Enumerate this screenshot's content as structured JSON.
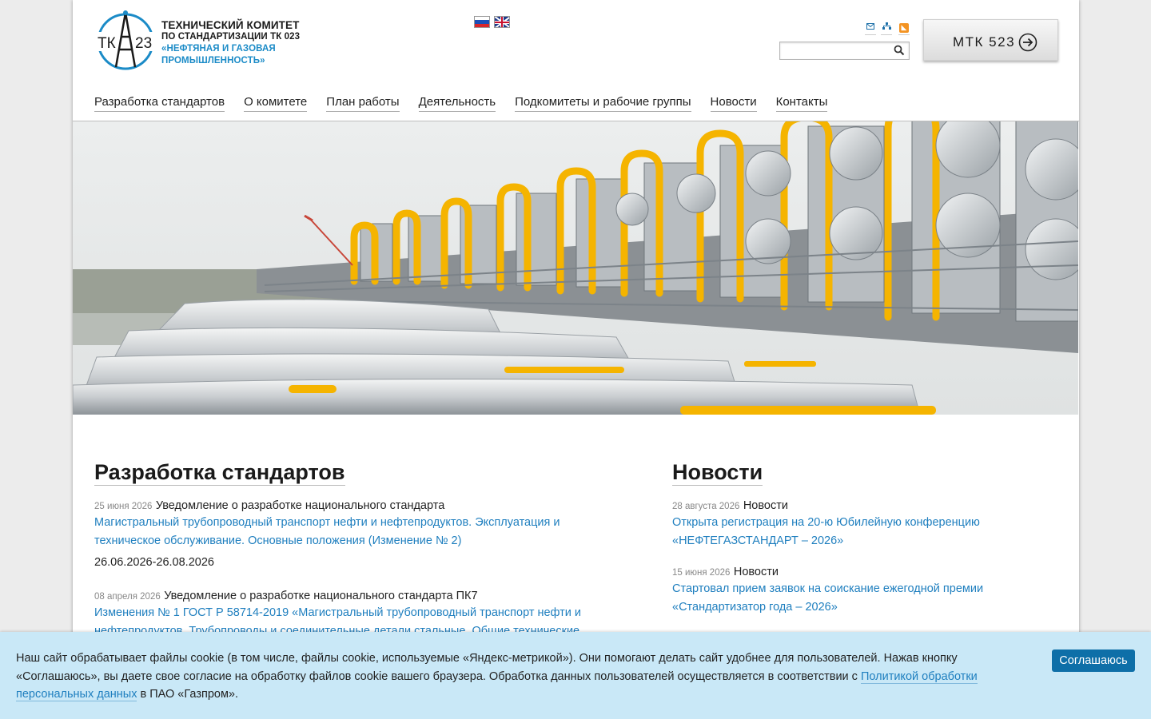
{
  "header": {
    "logo_text": [
      "ТЕХНИЧЕСКИЙ КОМИТЕТ",
      "ПО СТАНДАРТИЗАЦИИ ТК 023",
      "«НЕФТЯНАЯ И ГАЗОВАЯ",
      "ПРОМЫШЛЕННОСТЬ»"
    ],
    "logo_mark": {
      "left": "ТК",
      "right": "23"
    },
    "languages": [
      "ru-flag-icon",
      "uk-flag-icon"
    ],
    "utility_icons": [
      "mail-icon",
      "sitemap-icon",
      "rss-icon"
    ],
    "search": {
      "value": "",
      "placeholder": ""
    },
    "mtk_button": "МТК 523"
  },
  "nav": {
    "items": [
      "Разработка стандартов",
      "О комитете",
      "План работы",
      "Деятельность",
      "Подкомитеты и рабочие группы",
      "Новости",
      "Контакты"
    ]
  },
  "standards": {
    "title": "Разработка стандартов",
    "items": [
      {
        "date": "25 июня 2026",
        "heading": "Уведомление о разработке национального стандарта",
        "link": "Магистральный трубопроводный транспорт нефти и нефтепродуктов. Эксплуатация и техническое обслуживание. Основные положения (Изменение № 2)",
        "period": "26.06.2026-26.08.2026"
      },
      {
        "date": "08 апреля 2026",
        "heading": "Уведомление о разработке национального стандарта ПК7",
        "link": "Изменения № 1 ГОСТ Р 58714-2019 «Магистральный трубопроводный транспорт нефти и нефтепродуктов. Трубопроводы и соединительные детали стальные. Общие технические"
      }
    ]
  },
  "news": {
    "title": "Новости",
    "items": [
      {
        "date": "28 августа 2026",
        "category": "Новости",
        "link": "Открыта регистрация на 20-ю Юбилейную конференцию «НЕФТЕГАЗСТАНДАРТ – 2026»"
      },
      {
        "date": "15 июня 2026",
        "category": "Новости",
        "link": "Стартовал прием заявок на соискание ежегодной премии «Стандартизатор года – 2026»"
      }
    ]
  },
  "cookie": {
    "text_before": "Наш сайт обрабатывает файлы cookie (в том числе, файлы cookie, используемые «Яндекс-метрикой»). Они помогают делать сайт удобнее для пользователей. Нажав кнопку «Соглашаюсь», вы даете свое согласие на обработку файлов cookie вашего браузера. Обработка данных пользователей осуществляется в соответствии с ",
    "link": "Политикой обработки персональных данных",
    "text_after": " в ПАО «Газпром».",
    "button": "Соглашаюсь"
  },
  "colors": {
    "accent": "#1f7fbf",
    "logo_blue": "#1b8bc7",
    "cookie_bg": "#c9e8f7",
    "cookie_button": "#0e6fa8",
    "pipes": "#f5b400"
  }
}
